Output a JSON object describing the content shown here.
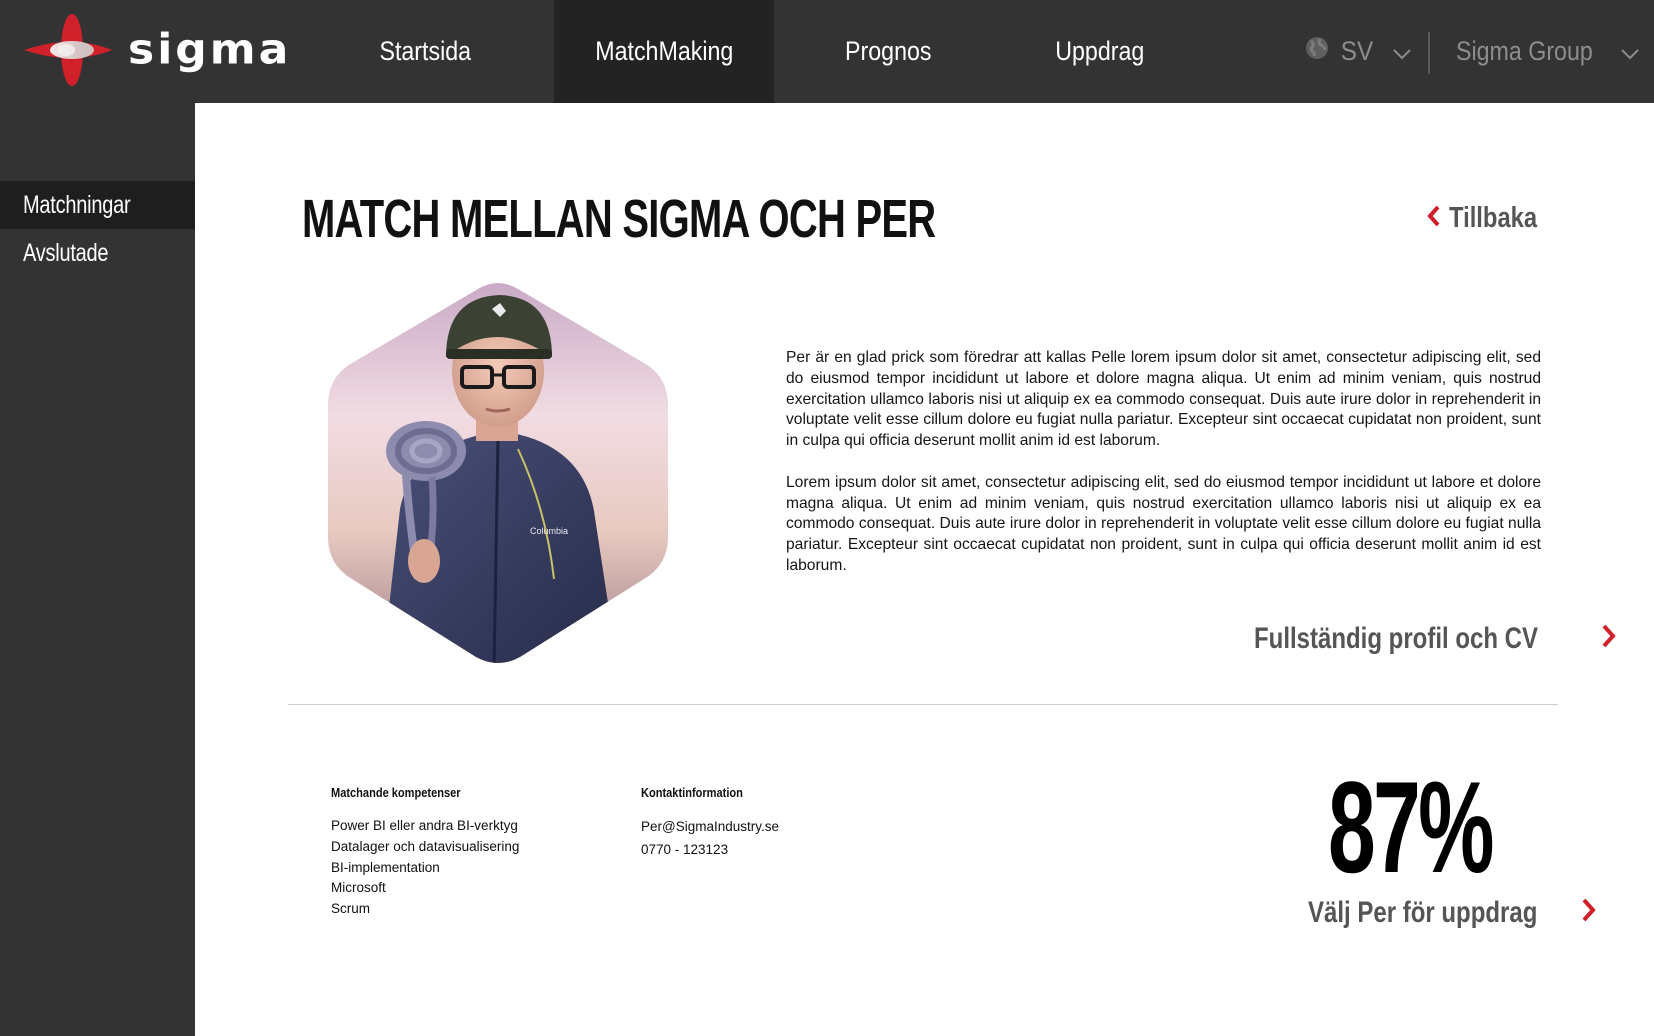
{
  "brand": {
    "name": "sigma"
  },
  "nav": {
    "items": [
      {
        "label": "Startsida"
      },
      {
        "label": "MatchMaking"
      },
      {
        "label": "Prognos"
      },
      {
        "label": "Uppdrag"
      }
    ],
    "active": "MatchMaking",
    "language": "SV",
    "company": "Sigma Group"
  },
  "sidebar": {
    "items": [
      {
        "label": "Matchningar"
      },
      {
        "label": "Avslutade"
      }
    ],
    "active": "Matchningar"
  },
  "main": {
    "title": "MATCH MELLAN SIGMA OCH PER",
    "back_label": "Tillbaka",
    "bio": [
      "Per är en glad prick som föredrar att kallas Pelle lorem ipsum dolor sit amet, consectetur adipiscing elit, sed do eiusmod tempor incididunt ut labore et dolore magna aliqua. Ut enim ad minim veniam, quis nostrud exercitation ullamco laboris nisi ut aliquip ex ea commodo consequat. Duis aute irure dolor in reprehenderit in voluptate velit esse cillum dolore eu fugiat nulla pariatur. Excepteur sint occaecat cupidatat non proident, sunt in culpa qui officia deserunt mollit anim id est laborum.",
      "Lorem ipsum dolor sit amet, consectetur adipiscing elit, sed do eiusmod tempor incididunt ut labore et dolore magna aliqua. Ut enim ad minim veniam, quis nostrud exercitation ullamco laboris nisi ut aliquip ex ea commodo consequat. Duis aute irure dolor in reprehenderit in voluptate velit esse cillum dolore eu fugiat nulla pariatur. Excepteur sint occaecat cupidatat non proident, sunt in culpa qui officia deserunt mollit anim id est laborum."
    ],
    "cv_link": "Fullständig profil och CV",
    "photo_text": "Columbia",
    "skills": {
      "heading": "Matchande kompetenser",
      "items": [
        "Power BI eller andra BI-verktyg",
        "Datalager och datavisualisering",
        "BI-implementation",
        "Microsoft",
        "Scrum"
      ]
    },
    "contact": {
      "heading": "Kontaktinformation",
      "email": "Per@SigmaIndustry.se",
      "phone": "0770 - 123123"
    },
    "match_score": "87%",
    "select_label": "Välj Per för uppdrag"
  },
  "colors": {
    "topbar": "#333334",
    "active_nav": "#232323",
    "accent_red": "#d0202a",
    "link_gray": "#555555"
  },
  "icons": [
    "sigma-logo-icon",
    "globe-icon",
    "chevron-down-icon",
    "chevron-left-icon",
    "chevron-right-icon"
  ]
}
